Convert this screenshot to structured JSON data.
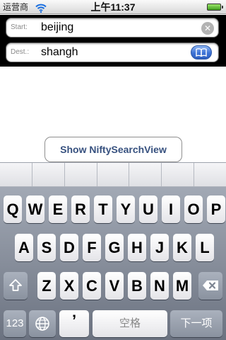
{
  "status_bar": {
    "carrier": "运营商",
    "time": "上午11:37",
    "wifi_icon": "wifi-icon",
    "battery_icon": "battery-full-icon"
  },
  "search": {
    "start_label": "Start:",
    "start_value": "beijing",
    "dest_label": "Dest.:",
    "dest_value": "shangh",
    "clear_icon": "clear-icon",
    "bookmarks_icon": "bookmarks-icon"
  },
  "main": {
    "show_button_label": "Show NiftySearchView"
  },
  "keyboard": {
    "row1": [
      "Q",
      "W",
      "E",
      "R",
      "T",
      "Y",
      "U",
      "I",
      "O",
      "P"
    ],
    "row2": [
      "A",
      "S",
      "D",
      "F",
      "G",
      "H",
      "J",
      "K",
      "L"
    ],
    "row3": [
      "Z",
      "X",
      "C",
      "V",
      "B",
      "N",
      "M"
    ],
    "numbers_label": "123",
    "apostrophe_label": "’",
    "space_label": "空格",
    "next_label": "下一项",
    "shift_icon": "shift-icon",
    "globe_icon": "globe-icon",
    "backspace_icon": "backspace-icon"
  },
  "colors": {
    "header_bg": "#000000",
    "button_text": "#37517f",
    "bookmarks_blue": "#3d72d6"
  }
}
